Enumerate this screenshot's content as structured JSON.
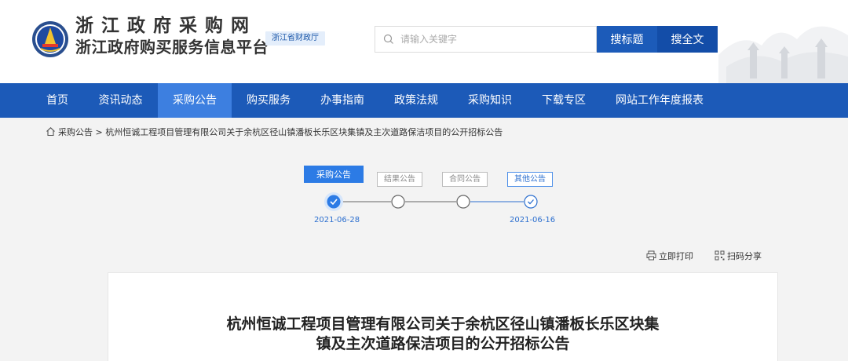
{
  "header": {
    "site_title": "浙江政府采购网",
    "site_subtitle": "浙江政府购买服务信息平台",
    "dept_badge": "浙江省财政厅",
    "search": {
      "placeholder": "请输入关键字",
      "value": ""
    },
    "search_title_button": "搜标题",
    "search_full_button": "搜全文",
    "colors": {
      "brand": "#1c5ab8",
      "nav_active": "#3d7fe0"
    }
  },
  "nav": {
    "items": [
      {
        "label": "首页",
        "active": false
      },
      {
        "label": "资讯动态",
        "active": false
      },
      {
        "label": "采购公告",
        "active": true
      },
      {
        "label": "购买服务",
        "active": false
      },
      {
        "label": "办事指南",
        "active": false
      },
      {
        "label": "政策法规",
        "active": false
      },
      {
        "label": "采购知识",
        "active": false
      },
      {
        "label": "下载专区",
        "active": false
      },
      {
        "label": "网站工作年度报表",
        "active": false
      }
    ]
  },
  "breadcrumb": {
    "home_icon": "home-icon",
    "section": "采购公告",
    "separator": ">",
    "current": "杭州恒诚工程项目管理有限公司关于余杭区径山镇潘板长乐区块集镇及主次道路保洁项目的公开招标公告"
  },
  "steps": {
    "items": [
      {
        "label": "采购公告",
        "state": "completed-current"
      },
      {
        "label": "结果公告",
        "state": "pending"
      },
      {
        "label": "合同公告",
        "state": "pending"
      },
      {
        "label": "其他公告",
        "state": "completed"
      }
    ],
    "dates": [
      "2021-06-28",
      "2021-06-16"
    ]
  },
  "tools": {
    "print_label": "立即打印",
    "share_label": "扫码分享"
  },
  "article": {
    "title_line1": "杭州恒诚工程项目管理有限公司关于余杭区径山镇潘板长乐区块集",
    "title_line2": "镇及主次道路保洁项目的公开招标公告"
  }
}
